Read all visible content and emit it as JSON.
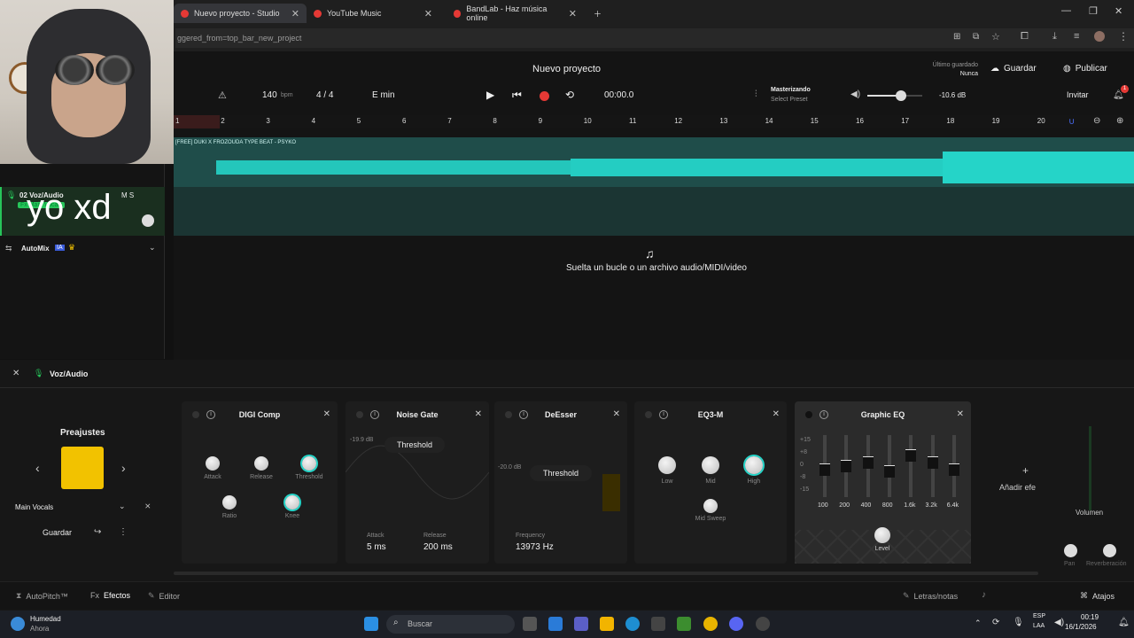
{
  "browser": {
    "tabs": [
      {
        "label": "Nuevo proyecto - Studio"
      },
      {
        "label": "YouTube Music"
      },
      {
        "label": "BandLab - Haz música online"
      }
    ],
    "address": "ggered_from=top_bar_new_project"
  },
  "webcam_overlay_text": "yo xd",
  "header": {
    "project_title": "Nuevo proyecto",
    "last_saved_label": "Último guardado",
    "last_saved_value": "Nunca",
    "save_label": "Guardar",
    "publish_label": "Publicar",
    "invite_label": "Invitar",
    "notification_count": "1"
  },
  "transport": {
    "tempo": "140",
    "tempo_unit": "bpm",
    "time_sig": "4 / 4",
    "key": "E min",
    "time": "00:00.0",
    "mastering_label": "Masterizando",
    "mastering_preset": "Select Preset",
    "master_volume": "-10.6 dB",
    "master_volume_level": 0.62
  },
  "ruler": [
    "1",
    "2",
    "3",
    "4",
    "5",
    "6",
    "7",
    "8",
    "9",
    "10",
    "11",
    "12",
    "13",
    "14",
    "15",
    "16",
    "17",
    "18",
    "19",
    "20"
  ],
  "tracks": {
    "track1_clip": "[FREE] DUKI X FROZOUDA TYPE BEAT - PSYKO",
    "track2_name": "02  Voz/Audio",
    "track2_tag": "Fx Main Vocals",
    "track2_ms": "M  S",
    "automix_label": "AutoMix",
    "automix_badge": "IA"
  },
  "drop_hint": "Suelta un bucle o un archivo audio/MIDI/video",
  "fx_panel": {
    "track_name": "Voz/Audio",
    "presets_title": "Preajustes",
    "preset_name": "Main Vocals",
    "save_label": "Guardar",
    "add_effect": "Añadir efe",
    "volume_label": "Volumen",
    "pan_label": "Pan",
    "reverb_label": "Reverberación"
  },
  "plugins": {
    "digicomp": {
      "title": "DIGI Comp",
      "knobs": [
        "Attack",
        "Release",
        "Threshold",
        "Ratio",
        "Knee"
      ]
    },
    "noisegate": {
      "title": "Noise Gate",
      "db": "-19.9 dB",
      "param": "Threshold",
      "attack_label": "Attack",
      "attack_value": "5 ms",
      "release_label": "Release",
      "release_value": "200 ms"
    },
    "deesser": {
      "title": "DeEsser",
      "db": "-20.0 dB",
      "param": "Threshold",
      "freq_label": "Frequency",
      "freq_value": "13973 Hz"
    },
    "eq3": {
      "title": "EQ3-M",
      "knobs": [
        "Low",
        "Mid",
        "High",
        "Mid Sweep"
      ]
    },
    "geq": {
      "title": "Graphic EQ",
      "scale": [
        "+15",
        "+8",
        "0",
        "-8",
        "-15"
      ],
      "bands": [
        "100",
        "200",
        "400",
        "800",
        "1.6k",
        "3.2k",
        "6.4k"
      ],
      "level_label": "Level"
    }
  },
  "bottom": {
    "autopitch": "AutoPitch™",
    "effects": "Efectos",
    "editor": "Editor",
    "lyrics": "Letras/notas",
    "shortcuts": "Atajos"
  },
  "taskbar": {
    "weather_title": "Humedad",
    "weather_sub": "Ahora",
    "search_placeholder": "Buscar",
    "lang1": "ESP",
    "lang2": "LAA",
    "time": "00:19",
    "date": "16/1/2026"
  },
  "colors": {
    "accent": "#25d4c8",
    "record": "#e53935",
    "gold": "#f2c200"
  }
}
